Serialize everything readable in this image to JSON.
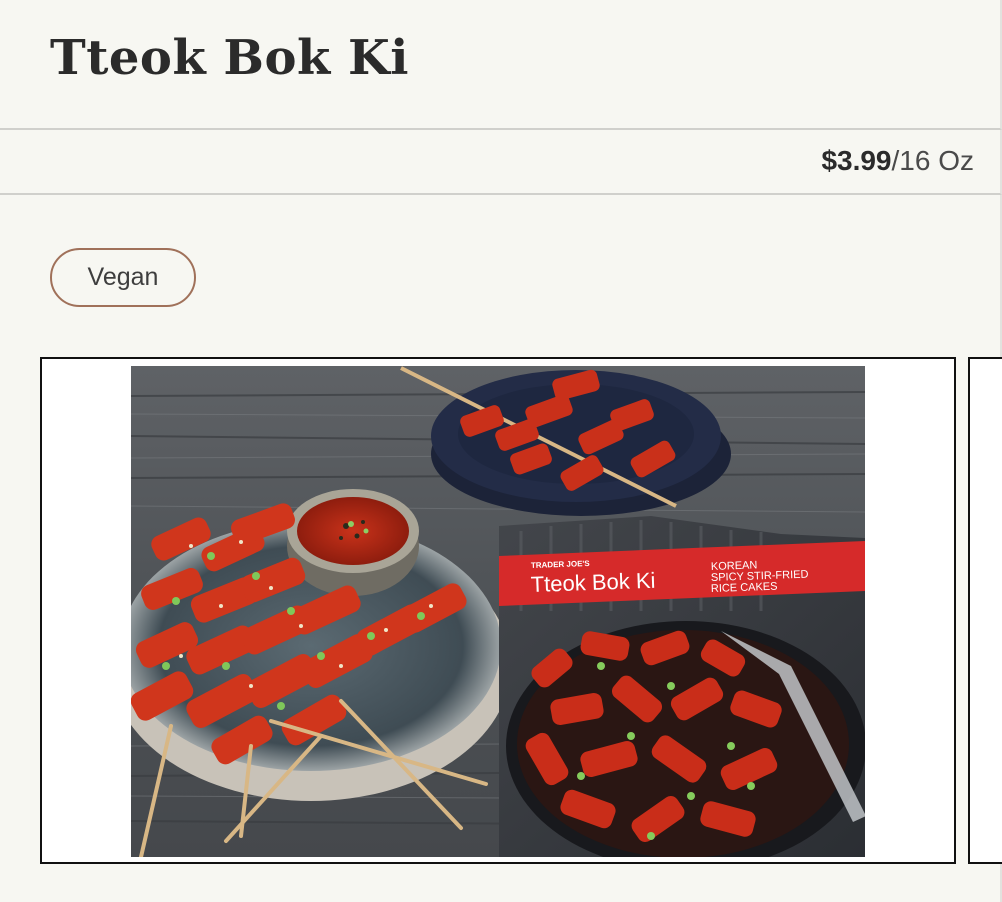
{
  "product": {
    "title": "Tteok Bok Ki",
    "price": "$3.99",
    "unit": "/16 Oz",
    "tags": [
      "Vegan"
    ]
  },
  "image": {
    "package_brand": "TRADER JOE'S",
    "package_title": "Tteok Bok Ki",
    "package_subtitle_1": "KOREAN",
    "package_subtitle_2": "SPICY STIR-FRIED",
    "package_subtitle_3": "RICE CAKES"
  },
  "colors": {
    "background": "#f7f7f2",
    "tag_border": "#a0715a",
    "divider": "#d0d0cc",
    "package_red": "#d62a2a"
  }
}
